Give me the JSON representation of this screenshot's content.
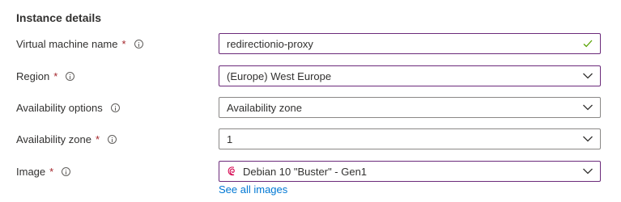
{
  "section": {
    "title": "Instance details"
  },
  "fields": {
    "vm_name": {
      "label": "Virtual machine name",
      "required_mark": "*",
      "value": "redirectionio-proxy"
    },
    "region": {
      "label": "Region",
      "required_mark": "*",
      "value": "(Europe) West Europe"
    },
    "availability_options": {
      "label": "Availability options",
      "value": "Availability zone"
    },
    "availability_zone": {
      "label": "Availability zone",
      "required_mark": "*",
      "value": "1"
    },
    "image": {
      "label": "Image",
      "required_mark": "*",
      "value": "Debian 10 \"Buster\" - Gen1",
      "icon": "debian-swirl-icon"
    }
  },
  "links": {
    "see_all_images": "See all images"
  },
  "colors": {
    "required": "#a4262c",
    "active_border": "#6b2a7a",
    "valid_check": "#57a300",
    "link": "#0078d4",
    "debian": "#d70a53"
  },
  "icons": {
    "info": "info-icon",
    "chevron": "chevron-down-icon",
    "valid": "checkmark-icon"
  }
}
